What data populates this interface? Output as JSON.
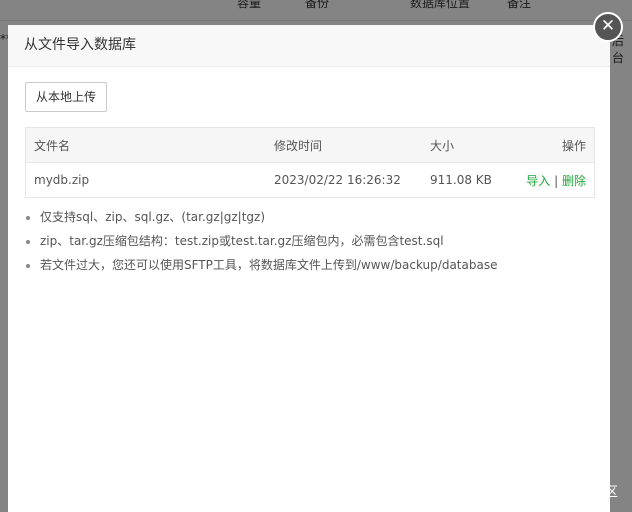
{
  "background": {
    "headers": [
      "容量",
      "备份",
      "数据库位置",
      "备注"
    ],
    "row_left": "**",
    "row_right": "后台"
  },
  "dialog": {
    "title": "从文件导入数据库",
    "upload_button": "从本地上传",
    "table": {
      "headers": [
        "文件名",
        "修改时间",
        "大小",
        "操作"
      ],
      "rows": [
        {
          "name": "mydb.zip",
          "mtime": "2023/02/22 16:26:32",
          "size": "911.08 KB",
          "import": "导入",
          "sep": "|",
          "delete": "删除"
        }
      ]
    },
    "tips": [
      "仅支持sql、zip、sql.gz、(tar.gz|gz|tgz)",
      "zip、tar.gz压缩包结构：test.zip或test.tar.gz压缩包内，必需包含test.sql",
      "若文件过大，您还可以使用SFTP工具，将数据库文件上传到/www/backup/database"
    ]
  },
  "watermark": "@稀土掘金技术社区"
}
